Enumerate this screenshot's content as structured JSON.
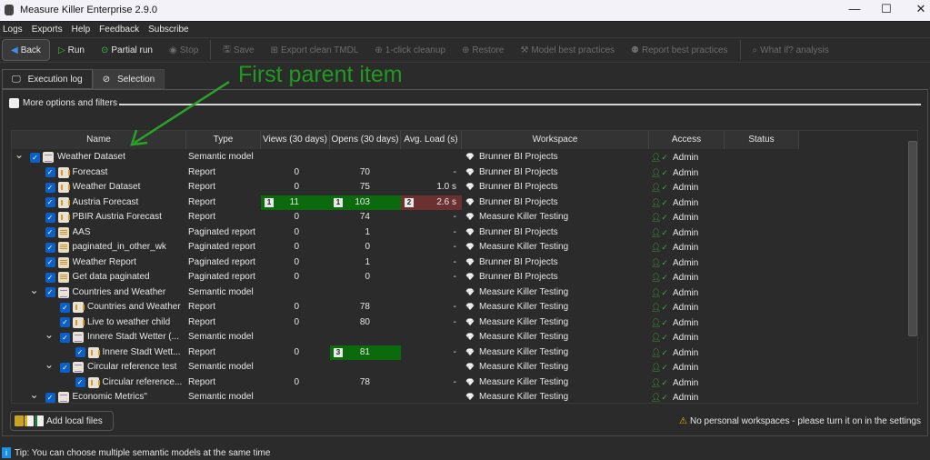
{
  "window": {
    "title": "Measure Killer Enterprise 2.9.0",
    "minimize": "—",
    "maximize": "☐",
    "close": "✕"
  },
  "menu": [
    "Logs",
    "Exports",
    "Help",
    "Feedback",
    "Subscribe"
  ],
  "toolbar": [
    {
      "label": "Back",
      "icon": "back-circle-icon",
      "enabled": true
    },
    {
      "label": "Run",
      "icon": "play-icon",
      "enabled": true
    },
    {
      "label": "Partial run",
      "icon": "play-circle-icon",
      "enabled": true
    },
    {
      "label": "Stop",
      "icon": "stop-icon",
      "enabled": false
    },
    {
      "label": "Save",
      "icon": "save-icon",
      "enabled": false
    },
    {
      "label": "Export clean TMDL",
      "icon": "export-icon",
      "enabled": false
    },
    {
      "label": "1-click cleanup",
      "icon": "cleanup-icon",
      "enabled": false
    },
    {
      "label": "Restore",
      "icon": "plus-circle-icon",
      "enabled": false
    },
    {
      "label": "Model best practices",
      "icon": "gavel-icon",
      "enabled": false
    },
    {
      "label": "Report best practices",
      "icon": "award-icon",
      "enabled": false
    },
    {
      "label": "What if? analysis",
      "icon": "search-icon",
      "enabled": false
    }
  ],
  "tabs": [
    {
      "label": "Execution log",
      "icon": "monitor-icon"
    },
    {
      "label": "Selection",
      "icon": "check-circle-icon"
    }
  ],
  "options": {
    "label": "More options and filters",
    "checked": false
  },
  "annotation": {
    "text": "First parent item",
    "color": "#1f9a1f"
  },
  "table": {
    "columns": [
      "Name",
      "Type",
      "Views (30 days)",
      "Opens (30 days)",
      "Avg. Load (s)",
      "Workspace",
      "Access",
      "Status"
    ],
    "rows": [
      {
        "level": 0,
        "expand": true,
        "kind": "sem",
        "name": "Weather Dataset",
        "type": "Semantic model",
        "views": "",
        "opens": "",
        "load": "",
        "workspace": "Brunner BI Projects",
        "access": "Admin"
      },
      {
        "level": 1,
        "kind": "rep",
        "name": "Forecast",
        "type": "Report",
        "views": "0",
        "opens": "70",
        "load": "-",
        "workspace": "Brunner BI Projects",
        "access": "Admin"
      },
      {
        "level": 1,
        "kind": "rep",
        "name": "Weather Dataset",
        "type": "Report",
        "views": "0",
        "opens": "75",
        "load": "1.0 s",
        "workspace": "Brunner BI Projects",
        "access": "Admin"
      },
      {
        "level": 1,
        "kind": "rep",
        "name": "Austria Forecast",
        "type": "Report",
        "views": "11",
        "views_rank": "1",
        "opens": "103",
        "opens_rank": "1",
        "load": "2.6 s",
        "load_rank": "2",
        "workspace": "Brunner BI Projects",
        "access": "Admin"
      },
      {
        "level": 1,
        "kind": "rep",
        "name": "PBIR Austria Forecast",
        "type": "Report",
        "views": "0",
        "opens": "74",
        "load": "-",
        "workspace": "Measure Killer Testing",
        "access": "Admin"
      },
      {
        "level": 1,
        "kind": "pag",
        "name": "AAS",
        "type": "Paginated report",
        "views": "0",
        "opens": "1",
        "load": "-",
        "workspace": "Brunner BI Projects",
        "access": "Admin"
      },
      {
        "level": 1,
        "kind": "pag",
        "name": "paginated_in_other_wk",
        "type": "Paginated report",
        "views": "0",
        "opens": "0",
        "load": "-",
        "workspace": "Measure Killer Testing",
        "access": "Admin"
      },
      {
        "level": 1,
        "kind": "pag",
        "name": "Weather Report",
        "type": "Paginated report",
        "views": "0",
        "opens": "1",
        "load": "-",
        "workspace": "Brunner BI Projects",
        "access": "Admin"
      },
      {
        "level": 1,
        "kind": "pag",
        "name": "Get data paginated",
        "type": "Paginated report",
        "views": "0",
        "opens": "0",
        "load": "-",
        "workspace": "Brunner BI Projects",
        "access": "Admin"
      },
      {
        "level": 1,
        "expand": true,
        "kind": "sem",
        "name": "Countries and Weather",
        "type": "Semantic model",
        "views": "",
        "opens": "",
        "load": "",
        "workspace": "Measure Killer Testing",
        "access": "Admin"
      },
      {
        "level": 2,
        "kind": "rep",
        "name": "Countries and Weather",
        "type": "Report",
        "views": "0",
        "opens": "78",
        "load": "-",
        "workspace": "Measure Killer Testing",
        "access": "Admin"
      },
      {
        "level": 2,
        "kind": "rep",
        "name": "Live to weather child",
        "type": "Report",
        "views": "0",
        "opens": "80",
        "load": "-",
        "workspace": "Measure Killer Testing",
        "access": "Admin"
      },
      {
        "level": 2,
        "expand": true,
        "kind": "sem",
        "name": "Innere Stadt Wetter (...",
        "type": "Semantic model",
        "views": "",
        "opens": "",
        "load": "",
        "workspace": "Measure Killer Testing",
        "access": "Admin"
      },
      {
        "level": 3,
        "kind": "rep",
        "name": "Innere Stadt Wett...",
        "type": "Report",
        "views": "0",
        "opens": "81",
        "opens_rank": "3",
        "load": "-",
        "workspace": "Measure Killer Testing",
        "access": "Admin"
      },
      {
        "level": 2,
        "expand": true,
        "kind": "sem",
        "name": "Circular reference test",
        "type": "Semantic model",
        "views": "",
        "opens": "",
        "load": "",
        "workspace": "Measure Killer Testing",
        "access": "Admin"
      },
      {
        "level": 3,
        "kind": "rep",
        "name": "Circular reference...",
        "type": "Report",
        "views": "0",
        "opens": "78",
        "load": "-",
        "workspace": "Measure Killer Testing",
        "access": "Admin"
      },
      {
        "level": 1,
        "expand": true,
        "kind": "sem",
        "name": "Economic Metrics\"",
        "type": "Semantic model",
        "views": "",
        "opens": "",
        "load": "",
        "workspace": "Measure Killer Testing",
        "access": "Admin"
      }
    ]
  },
  "add_files": {
    "label": "Add local files"
  },
  "warning": "No personal workspaces - please turn it on in the settings",
  "tip": "Tip: You can choose multiple semantic models at the same time",
  "colors": {
    "highlight_green": "#0b6a0b",
    "highlight_red": "#6b3030",
    "checkbox": "#0a5fc8",
    "access_green": "#3faa3f"
  }
}
